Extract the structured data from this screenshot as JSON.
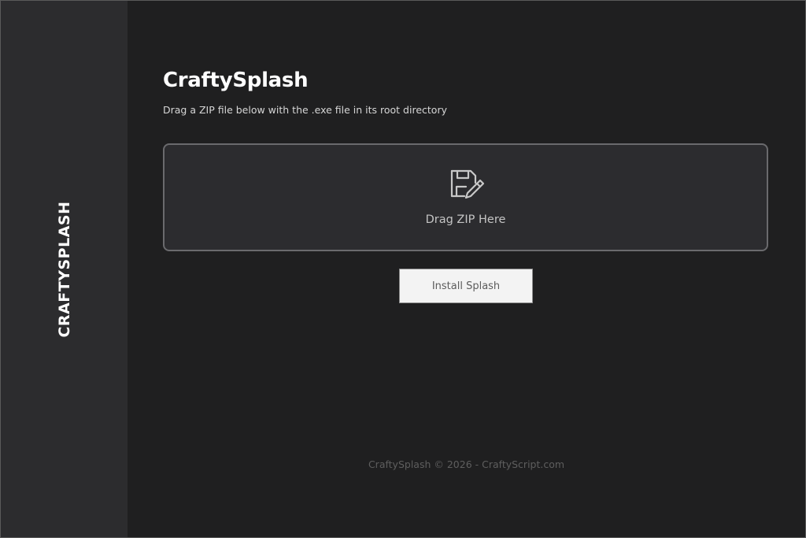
{
  "sidebar": {
    "brand": "CRAFTYSPLASH"
  },
  "header": {
    "title": "CraftySplash",
    "subtitle": "Drag a ZIP file below with the .exe file in its root directory"
  },
  "dropzone": {
    "icon": "floppy-disk-pencil-icon",
    "label": "Drag ZIP Here"
  },
  "actions": {
    "install_label": "Install Splash"
  },
  "footer": {
    "text": "CraftySplash © 2026 - CraftyScript.com"
  },
  "colors": {
    "background": "#1f1f20",
    "sidebar": "#2c2c2e",
    "dropzone_fill": "#2c2c2f",
    "dropzone_border": "#6a6a6d",
    "button_fill": "#f3f3f3"
  }
}
